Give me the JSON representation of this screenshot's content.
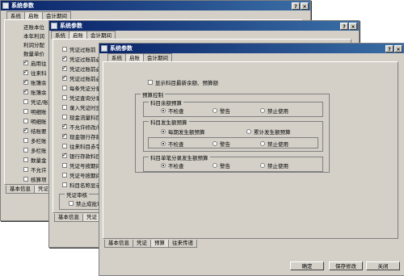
{
  "window_title": "系统参数",
  "title_buttons": {
    "help": "?",
    "close": "×"
  },
  "top_tabs": [
    "系统",
    "启账",
    "会计期间"
  ],
  "win1": {
    "labels": [
      "还账本位",
      "本年利润",
      "利润分配",
      "数量单价"
    ],
    "checkboxes": [
      {
        "label": "启用往",
        "checked": true
      },
      {
        "label": "往来科",
        "checked": true
      },
      {
        "label": "账簿余",
        "checked": true
      },
      {
        "label": "账簿余",
        "checked": true
      },
      {
        "label": "凭证/账",
        "checked": false
      },
      {
        "label": "明细账",
        "checked": false
      },
      {
        "label": "明细账",
        "checked": false
      },
      {
        "label": "结账要",
        "checked": true
      },
      {
        "label": "多栏账",
        "checked": false
      },
      {
        "label": "多栏账",
        "checked": false
      },
      {
        "label": "数量金",
        "checked": false
      },
      {
        "label": "不允许",
        "checked": false
      },
      {
        "label": "核算项",
        "checked": false
      }
    ],
    "bottom_tabs": [
      "基本信息",
      "凭证"
    ]
  },
  "win2": {
    "checkboxes": [
      {
        "label": "凭证过账前",
        "checked": false
      },
      {
        "label": "凭证过账前必",
        "checked": true
      },
      {
        "label": "凭证过账前必",
        "checked": true
      },
      {
        "label": "凭证过账前必",
        "checked": true
      },
      {
        "label": "每条凭证分录",
        "checked": false
      },
      {
        "label": "凭证查询分录",
        "checked": false
      },
      {
        "label": "录入凭证时显",
        "checked": false
      },
      {
        "label": "现金流量科目",
        "checked": false
      },
      {
        "label": "不允许修改/删",
        "checked": true
      },
      {
        "label": "现金银行存款",
        "checked": true
      },
      {
        "label": "往来科目赤字",
        "checked": false
      },
      {
        "label": "银行存款科目",
        "checked": true
      },
      {
        "label": "凭证号按期间",
        "checked": false
      },
      {
        "label": "凭证号按期间",
        "checked": false
      },
      {
        "label": "科目名称显示",
        "checked": false
      }
    ],
    "group_label": "凭证审核",
    "group_checkbox": {
      "label": "禁止成批审核",
      "checked": false
    },
    "bottom_tabs": [
      "基本信息",
      "凭证",
      "预算"
    ]
  },
  "win3": {
    "show_balance": {
      "label": "显示科目最新余额、预算额",
      "checked": false
    },
    "budget_group": "预算控制",
    "subgroups": [
      {
        "title": "科目余额预算",
        "options": [
          {
            "label": "不检查",
            "selected": true
          },
          {
            "label": "警告",
            "selected": false
          },
          {
            "label": "禁止使用",
            "selected": false
          }
        ]
      },
      {
        "title": "科目发生额预算",
        "options": [
          {
            "label": "每期发生额预算",
            "selected": true
          },
          {
            "label": "累计发生额预算",
            "selected": false
          }
        ]
      },
      {
        "title": "",
        "options": [
          {
            "label": "不检查",
            "selected": true
          },
          {
            "label": "警告",
            "selected": false
          },
          {
            "label": "禁止使用",
            "selected": false
          }
        ]
      }
    ],
    "entry_group": {
      "title": "科目单笔分录发生额预算",
      "options": [
        {
          "label": "不检查",
          "selected": true
        },
        {
          "label": "警告",
          "selected": false
        },
        {
          "label": "禁止使用",
          "selected": false
        }
      ]
    },
    "bottom_tabs": [
      "基本信息",
      "凭证",
      "预算",
      "往来传递"
    ],
    "buttons": {
      "ok": "确定",
      "save": "保存修改",
      "close": "关闭"
    }
  }
}
